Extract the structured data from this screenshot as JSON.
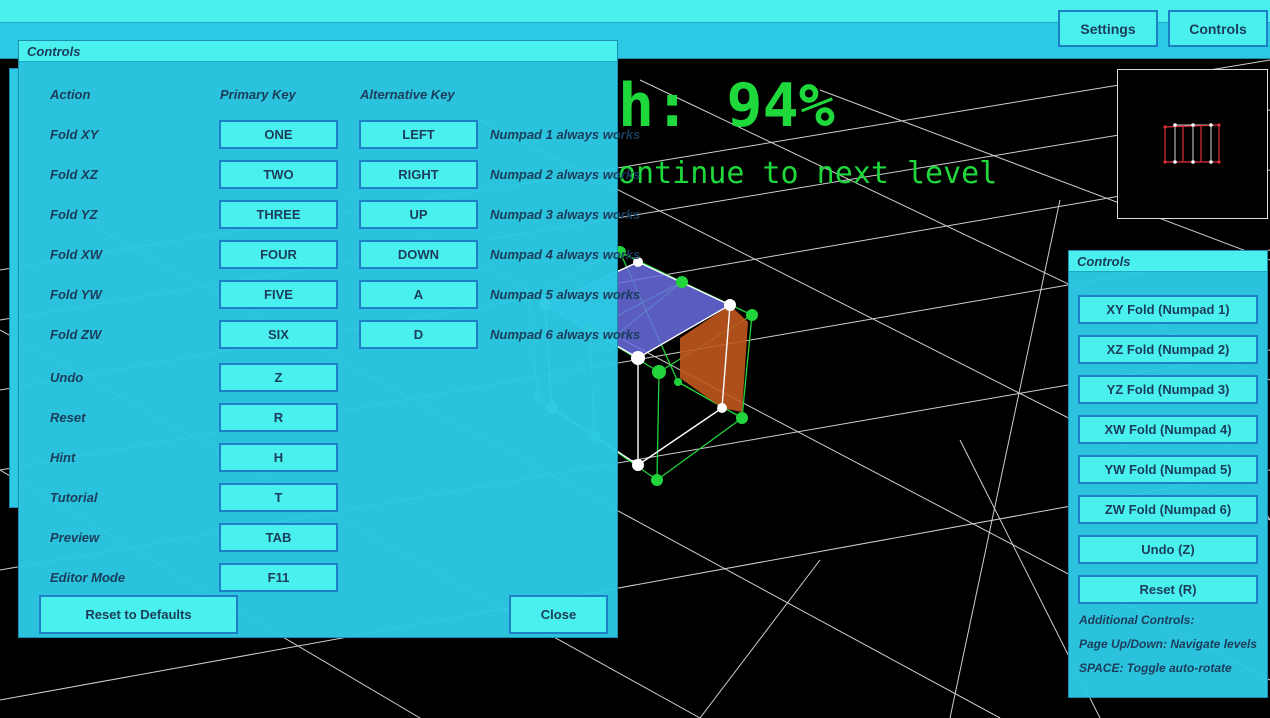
{
  "hud": {
    "completion": "h: 94%",
    "message": "ontinue to next level"
  },
  "topbar": {
    "settings_label": "Settings",
    "controls_label": "Controls"
  },
  "left_panel": {
    "title": "Controls",
    "headers": {
      "action": "Action",
      "primary": "Primary Key",
      "alternative": "Alternative Key"
    },
    "rows": [
      {
        "action": "Fold XY",
        "primary": "ONE",
        "alt": "LEFT",
        "note": "Numpad 1 always works"
      },
      {
        "action": "Fold XZ",
        "primary": "TWO",
        "alt": "RIGHT",
        "note": "Numpad 2 always works"
      },
      {
        "action": "Fold YZ",
        "primary": "THREE",
        "alt": "UP",
        "note": "Numpad 3 always works"
      },
      {
        "action": "Fold XW",
        "primary": "FOUR",
        "alt": "DOWN",
        "note": "Numpad 4 always works"
      },
      {
        "action": "Fold YW",
        "primary": "FIVE",
        "alt": "A",
        "note": "Numpad 5 always works"
      },
      {
        "action": "Fold ZW",
        "primary": "SIX",
        "alt": "D",
        "note": "Numpad 6 always works"
      },
      {
        "action": "Undo",
        "primary": "Z"
      },
      {
        "action": "Reset",
        "primary": "R"
      },
      {
        "action": "Hint",
        "primary": "H"
      },
      {
        "action": "Tutorial",
        "primary": "T"
      },
      {
        "action": "Preview",
        "primary": "TAB"
      },
      {
        "action": "Editor Mode",
        "primary": "F11"
      }
    ],
    "reset_defaults_label": "Reset to Defaults",
    "close_label": "Close"
  },
  "right_panel": {
    "title": "Controls",
    "buttons": [
      "XY Fold (Numpad 1)",
      "XZ Fold (Numpad 2)",
      "YZ Fold (Numpad 3)",
      "XW Fold (Numpad 4)",
      "YW Fold (Numpad 5)",
      "ZW Fold (Numpad 6)",
      "Undo (Z)",
      "Reset (R)"
    ],
    "info": [
      "Additional Controls:",
      "Page Up/Down: Navigate levels",
      "SPACE: Toggle auto-rotate"
    ]
  },
  "colors": {
    "panel": "#2cc8e4",
    "panel_title": "#4af0ee",
    "button": "#4af0ee",
    "button_border": "#1d7fc4",
    "hud_green": "#1fd83c",
    "face_blue": "#6a6ce0",
    "face_orange": "#c0561e"
  }
}
